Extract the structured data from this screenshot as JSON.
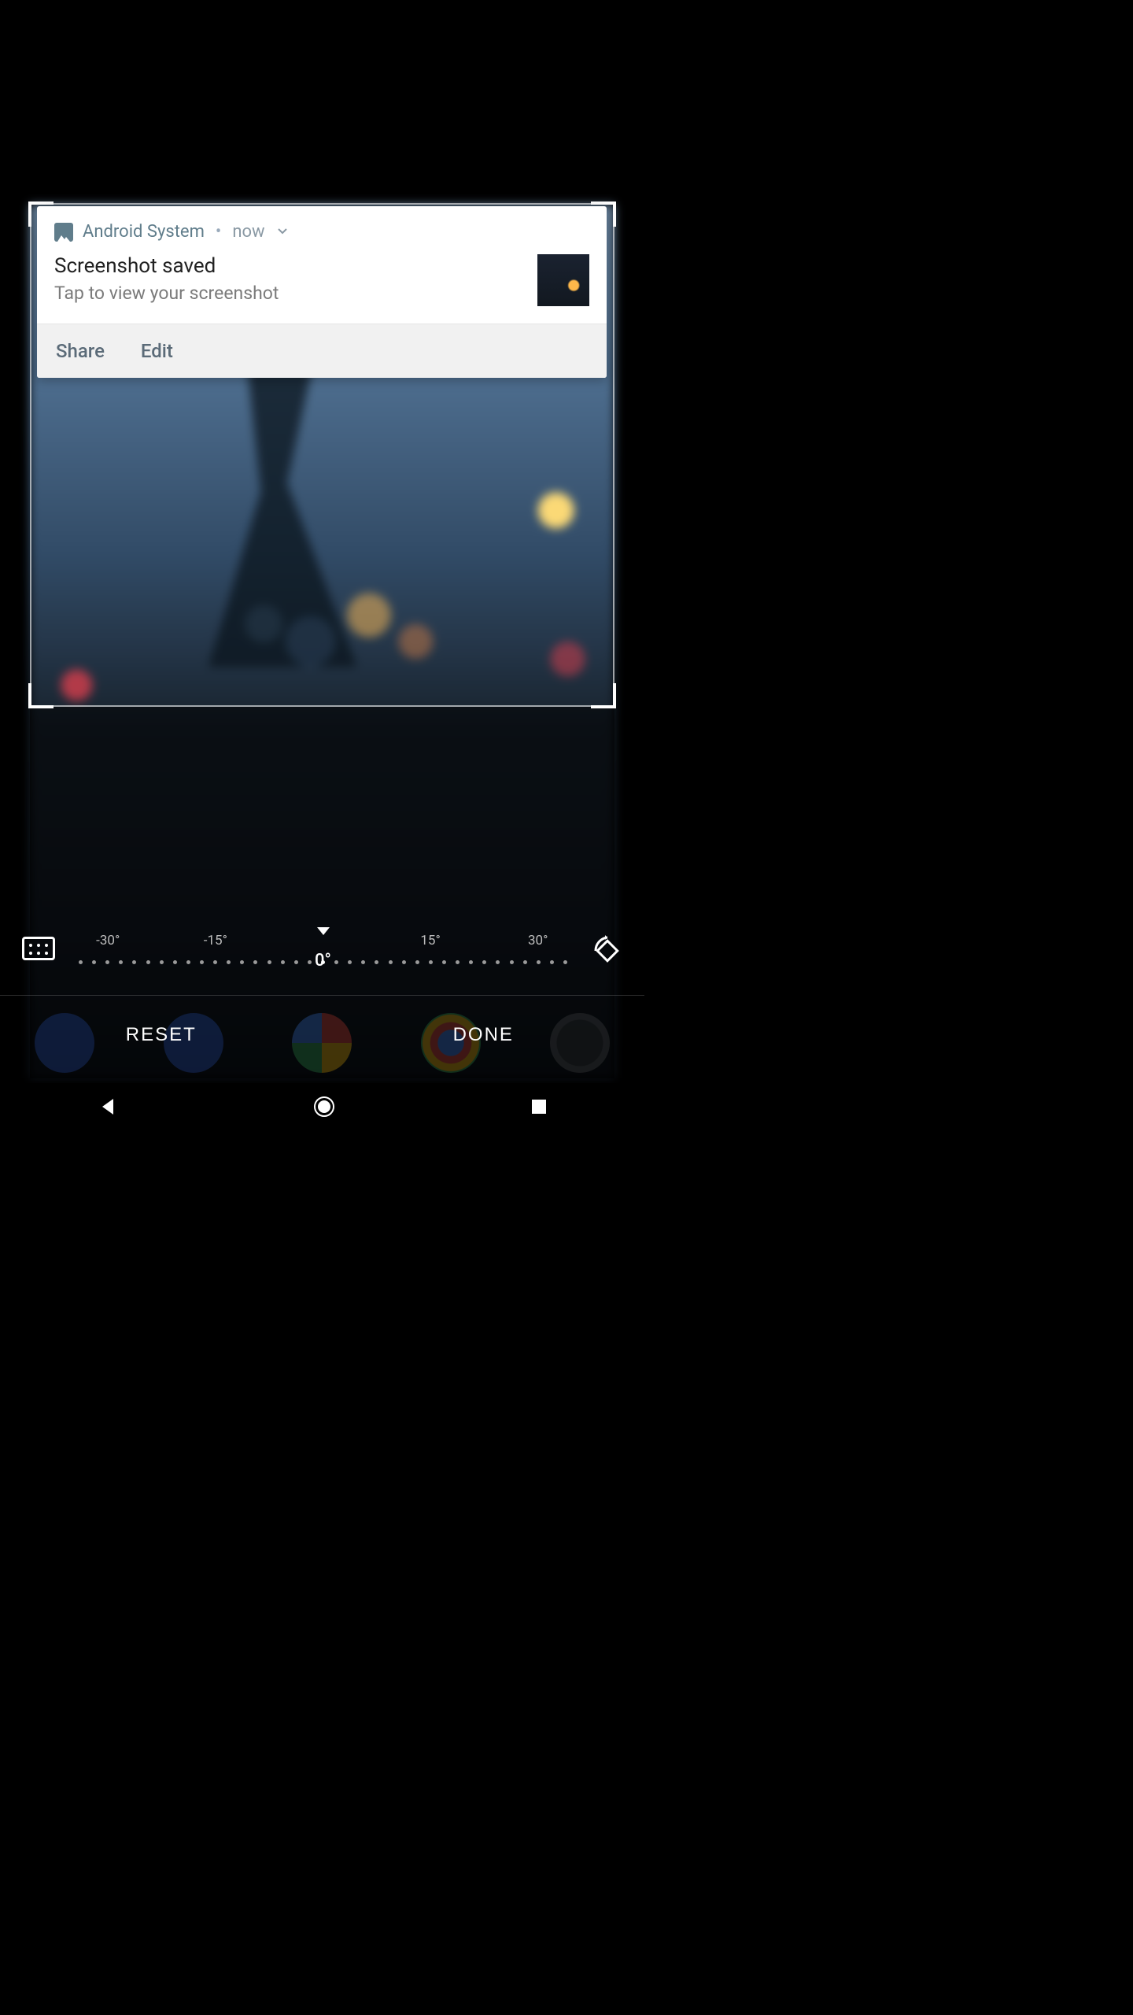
{
  "notification": {
    "app_name": "Android System",
    "time": "now",
    "title": "Screenshot saved",
    "subtitle": "Tap to view your screenshot",
    "actions": {
      "share": "Share",
      "edit": "Edit"
    }
  },
  "dial": {
    "labels": [
      "-30°",
      "-15°",
      "15°",
      "30°"
    ],
    "current": "0°"
  },
  "action_bar": {
    "reset": "RESET",
    "done": "DONE"
  }
}
